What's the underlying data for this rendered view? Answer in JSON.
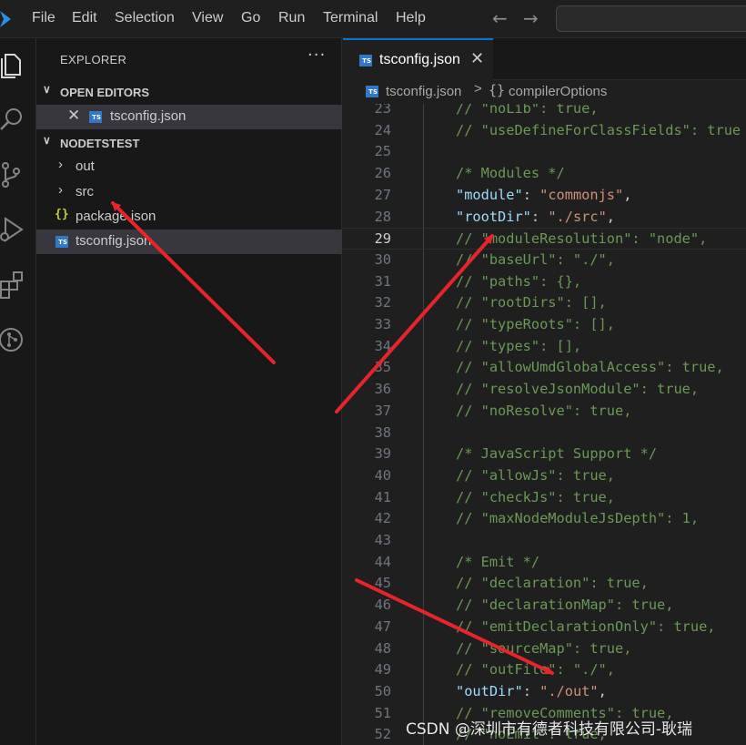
{
  "menu": [
    "File",
    "Edit",
    "Selection",
    "View",
    "Go",
    "Run",
    "Terminal",
    "Help"
  ],
  "colors": {
    "accent": "#0078d4",
    "annotation_arrow": "#e8242b",
    "ts_badge": "#3178c6",
    "json_icon": "#cbcb41",
    "comment": "#6a9955",
    "property_key": "#9cdcfe",
    "string": "#ce9178"
  },
  "activity_icons": [
    "explorer-icon",
    "search-icon",
    "source-control-icon",
    "run-debug-icon",
    "extensions-icon",
    "git-graph-icon"
  ],
  "explorer": {
    "title": "EXPLORER",
    "more": "···",
    "open_editors": {
      "label": "OPEN EDITORS",
      "items": [
        {
          "name": "tsconfig.json",
          "icon": "typescript-config-icon"
        }
      ]
    },
    "workspace": {
      "label": "NODETSTEST",
      "items": [
        {
          "name": "out",
          "type": "folder"
        },
        {
          "name": "src",
          "type": "folder"
        },
        {
          "name": "package.json",
          "type": "file",
          "icon": "json-braces-icon"
        },
        {
          "name": "tsconfig.json",
          "type": "file",
          "icon": "typescript-config-icon",
          "selected": true
        }
      ]
    }
  },
  "tab": {
    "label": "tsconfig.json",
    "close": "✕"
  },
  "breadcrumb": {
    "file": "tsconfig.json",
    "separator": ">",
    "symbol": "{}",
    "node": "compilerOptions"
  },
  "editor": {
    "active_line": 29,
    "lines": [
      {
        "n": "23",
        "tokens": [
          {
            "t": "// \"noLib\": true,",
            "c": "cm"
          }
        ]
      },
      {
        "n": "24",
        "tokens": [
          {
            "t": "// \"useDefineForClassFields\": true",
            "c": "cm"
          }
        ]
      },
      {
        "n": "25",
        "tokens": []
      },
      {
        "n": "26",
        "tokens": [
          {
            "t": "/* Modules */",
            "c": "cm"
          }
        ]
      },
      {
        "n": "27",
        "tokens": [
          {
            "t": "\"module\"",
            "c": "key"
          },
          {
            "t": ": ",
            "c": "pun"
          },
          {
            "t": "\"commonjs\"",
            "c": "str"
          },
          {
            "t": ",",
            "c": "pun"
          }
        ]
      },
      {
        "n": "28",
        "tokens": [
          {
            "t": "\"rootDir\"",
            "c": "key"
          },
          {
            "t": ": ",
            "c": "pun"
          },
          {
            "t": "\"./src\"",
            "c": "str"
          },
          {
            "t": ",",
            "c": "pun"
          }
        ]
      },
      {
        "n": "29",
        "tokens": [
          {
            "t": "// \"moduleResolution\": \"node\",",
            "c": "cm"
          }
        ]
      },
      {
        "n": "30",
        "tokens": [
          {
            "t": "// \"baseUrl\": \"./\",",
            "c": "cm"
          }
        ]
      },
      {
        "n": "31",
        "tokens": [
          {
            "t": "// \"paths\": {},",
            "c": "cm"
          }
        ]
      },
      {
        "n": "32",
        "tokens": [
          {
            "t": "// \"rootDirs\": [],",
            "c": "cm"
          }
        ]
      },
      {
        "n": "33",
        "tokens": [
          {
            "t": "// \"typeRoots\": [],",
            "c": "cm"
          }
        ]
      },
      {
        "n": "34",
        "tokens": [
          {
            "t": "// \"types\": [],",
            "c": "cm"
          }
        ]
      },
      {
        "n": "35",
        "tokens": [
          {
            "t": "// \"allowUmdGlobalAccess\": true,",
            "c": "cm"
          }
        ]
      },
      {
        "n": "36",
        "tokens": [
          {
            "t": "// \"resolveJsonModule\": true,",
            "c": "cm"
          }
        ]
      },
      {
        "n": "37",
        "tokens": [
          {
            "t": "// \"noResolve\": true,",
            "c": "cm"
          }
        ]
      },
      {
        "n": "38",
        "tokens": []
      },
      {
        "n": "39",
        "tokens": [
          {
            "t": "/* JavaScript Support */",
            "c": "cm"
          }
        ]
      },
      {
        "n": "40",
        "tokens": [
          {
            "t": "// \"allowJs\": true,",
            "c": "cm"
          }
        ]
      },
      {
        "n": "41",
        "tokens": [
          {
            "t": "// \"checkJs\": true,",
            "c": "cm"
          }
        ]
      },
      {
        "n": "42",
        "tokens": [
          {
            "t": "// \"maxNodeModuleJsDepth\": 1,",
            "c": "cm"
          }
        ]
      },
      {
        "n": "43",
        "tokens": []
      },
      {
        "n": "44",
        "tokens": [
          {
            "t": "/* Emit */",
            "c": "cm"
          }
        ]
      },
      {
        "n": "45",
        "tokens": [
          {
            "t": "// \"declaration\": true,",
            "c": "cm"
          }
        ]
      },
      {
        "n": "46",
        "tokens": [
          {
            "t": "// \"declarationMap\": true,",
            "c": "cm"
          }
        ]
      },
      {
        "n": "47",
        "tokens": [
          {
            "t": "// \"emitDeclarationOnly\": true,",
            "c": "cm"
          }
        ]
      },
      {
        "n": "48",
        "tokens": [
          {
            "t": "// \"sourceMap\": true,",
            "c": "cm"
          }
        ]
      },
      {
        "n": "49",
        "tokens": [
          {
            "t": "// \"outFile\": \"./\",",
            "c": "cm"
          }
        ]
      },
      {
        "n": "50",
        "tokens": [
          {
            "t": "\"outDir\"",
            "c": "key"
          },
          {
            "t": ": ",
            "c": "pun"
          },
          {
            "t": "\"./out\"",
            "c": "str"
          },
          {
            "t": ",",
            "c": "pun"
          }
        ]
      },
      {
        "n": "51",
        "tokens": [
          {
            "t": "// \"removeComments\": true,",
            "c": "cm"
          }
        ]
      },
      {
        "n": "52",
        "tokens": [
          {
            "t": "// \"noEmit\": true,",
            "c": "cm"
          }
        ]
      }
    ]
  },
  "watermark": "CSDN @深圳市有德者科技有限公司-耿瑞"
}
